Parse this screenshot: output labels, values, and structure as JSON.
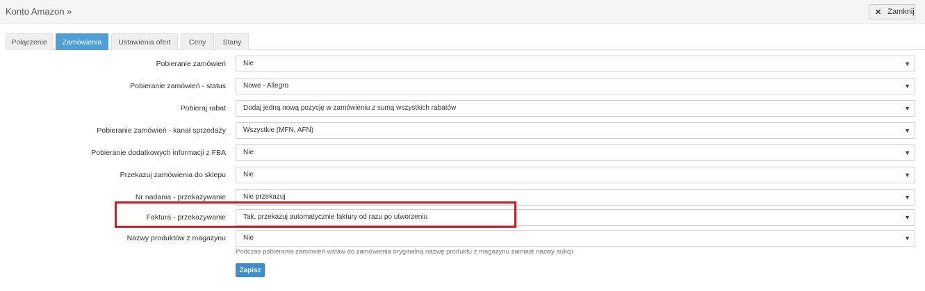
{
  "header": {
    "title": "Konto Amazon »",
    "close_label": "Zamknij"
  },
  "tabs": [
    {
      "label": "Połączenie",
      "active": false
    },
    {
      "label": "Zamówienia",
      "active": true
    },
    {
      "label": "Ustawienia ofert",
      "active": false
    },
    {
      "label": "Ceny",
      "active": false
    },
    {
      "label": "Stany",
      "active": false
    }
  ],
  "form": {
    "rows": [
      {
        "label": "Pobieranie zamówień",
        "value": "Nie"
      },
      {
        "label": "Pobieranie zamówień - status",
        "value": "Nowe - Allegro"
      },
      {
        "label": "Pobieraj rabat",
        "value": "Dodaj jedną nową pozycję w zamówieniu z sumą wszystkich rabatów"
      },
      {
        "label": "Pobieranie zamówień - kanał sprzedaży",
        "value": "Wszystkie (MFN, AFN)"
      },
      {
        "label": "Pobieranie dodatkowych informacji z FBA",
        "value": "Nie"
      },
      {
        "label": "Przekazuj zamówienia do sklepu",
        "value": "Nie"
      },
      {
        "label": "Nr nadania - przekazywanie",
        "value": "Nie przekazuj"
      },
      {
        "label": "Faktura - przekazywanie",
        "value": "Tak, przekazuj automatycznie faktury od razu po utworzeniu"
      },
      {
        "label": "Nazwy produktów z magazynu",
        "value": "Nie"
      }
    ],
    "hint": "Podczas pobierania zamówień wstaw do zamówienia oryginalną nazwę produktu z magazynu zamiast nazwy aukcji",
    "save_label": "Zapisz"
  },
  "colors": {
    "accent": "#4d9fd6",
    "highlight": "#e1151b"
  },
  "icons": {
    "close": "close-icon",
    "dropdown": "chevron-down-icon"
  }
}
